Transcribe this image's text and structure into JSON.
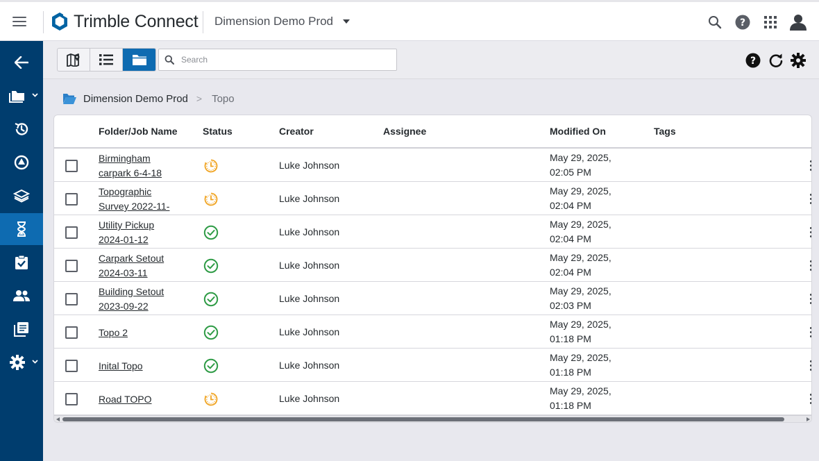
{
  "header": {
    "brand": "Trimble Connect",
    "project": "Dimension Demo Prod"
  },
  "sidebar": {
    "items": [
      {
        "icon": "back-arrow-icon"
      },
      {
        "icon": "folder-icon"
      },
      {
        "icon": "history-icon"
      },
      {
        "icon": "shape-icon"
      },
      {
        "icon": "layers-icon"
      },
      {
        "icon": "hourglass-icon",
        "active": true
      },
      {
        "icon": "clipboard-check-icon"
      },
      {
        "icon": "team-icon"
      },
      {
        "icon": "reports-icon"
      },
      {
        "icon": "settings-icon"
      }
    ]
  },
  "toolbar": {
    "search_placeholder": "Search"
  },
  "breadcrumb": {
    "root": "Dimension Demo Prod",
    "separator": ">",
    "current": "Topo"
  },
  "table": {
    "columns": [
      "Folder/Job Name",
      "Status",
      "Creator",
      "Assignee",
      "Modified On",
      "Tags"
    ],
    "rows": [
      {
        "name_line1": "Birmingham",
        "name_line2": "carpark 6-4-18",
        "status": "pending",
        "creator": "Luke Johnson",
        "assignee": "",
        "modified_date": "May 29, 2025,",
        "modified_time": "02:05 PM",
        "tags": ""
      },
      {
        "name_line1": "Topographic",
        "name_line2": "Survey 2022-11-",
        "status": "pending",
        "creator": "Luke Johnson",
        "assignee": "",
        "modified_date": "May 29, 2025,",
        "modified_time": "02:04 PM",
        "tags": ""
      },
      {
        "name_line1": "Utility Pickup",
        "name_line2": "2024-01-12",
        "status": "complete",
        "creator": "Luke Johnson",
        "assignee": "",
        "modified_date": "May 29, 2025,",
        "modified_time": "02:04 PM",
        "tags": ""
      },
      {
        "name_line1": "Carpark Setout",
        "name_line2": "2024-03-11",
        "status": "complete",
        "creator": "Luke Johnson",
        "assignee": "",
        "modified_date": "May 29, 2025,",
        "modified_time": "02:04 PM",
        "tags": ""
      },
      {
        "name_line1": "Building Setout",
        "name_line2": "2023-09-22",
        "status": "complete",
        "creator": "Luke Johnson",
        "assignee": "",
        "modified_date": "May 29, 2025,",
        "modified_time": "02:03 PM",
        "tags": ""
      },
      {
        "name_line1": "Topo 2",
        "name_line2": "",
        "status": "complete",
        "creator": "Luke Johnson",
        "assignee": "",
        "modified_date": "May 29, 2025,",
        "modified_time": "01:18 PM",
        "tags": ""
      },
      {
        "name_line1": "Inital Topo",
        "name_line2": "",
        "status": "complete",
        "creator": "Luke Johnson",
        "assignee": "",
        "modified_date": "May 29, 2025,",
        "modified_time": "01:18 PM",
        "tags": ""
      },
      {
        "name_line1": "Road TOPO",
        "name_line2": "",
        "status": "pending",
        "creator": "Luke Johnson",
        "assignee": "",
        "modified_date": "May 29, 2025,",
        "modified_time": "01:18 PM",
        "tags": ""
      }
    ]
  },
  "colors": {
    "sidebar_bg": "#003d6e",
    "accent": "#0e6bb1",
    "status_complete": "#2e9b45",
    "status_pending": "#f0a320"
  }
}
